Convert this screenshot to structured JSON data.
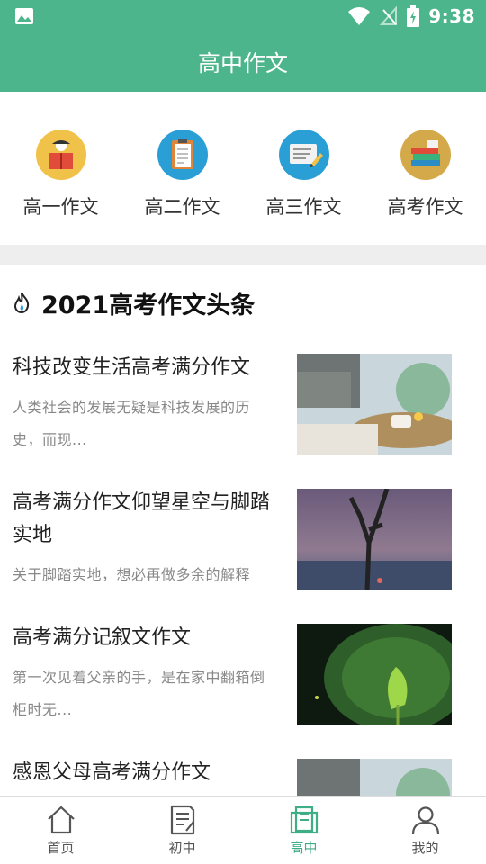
{
  "status": {
    "time": "9:38"
  },
  "appbar": {
    "title": "高中作文"
  },
  "categories": [
    {
      "label": "高一作文",
      "icon": "reading-person-icon"
    },
    {
      "label": "高二作文",
      "icon": "clipboard-icon"
    },
    {
      "label": "高三作文",
      "icon": "writing-board-icon"
    },
    {
      "label": "高考作文",
      "icon": "books-stack-icon"
    }
  ],
  "section": {
    "title": "2021高考作文头条"
  },
  "articles": [
    {
      "title": "科技改变生活高考满分作文",
      "desc": "人类社会的发展无疑是科技发展的历史，而现..."
    },
    {
      "title": "高考满分作文仰望星空与脚踏实地",
      "desc": "关于脚踏实地，想必再做多余的解释"
    },
    {
      "title": "高考满分记叙文作文",
      "desc": "第一次见着父亲的手，是在家中翻箱倒柜时无..."
    },
    {
      "title": "感恩父母高考满分作文",
      "desc": ""
    }
  ],
  "tabs": [
    {
      "label": "首页"
    },
    {
      "label": "初中"
    },
    {
      "label": "高中"
    },
    {
      "label": "我的"
    }
  ],
  "colors": {
    "brand": "#4db58c",
    "active_tab": "#3fae86"
  }
}
